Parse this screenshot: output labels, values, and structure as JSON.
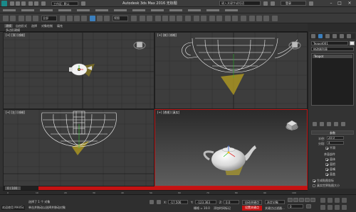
{
  "titlebar": {
    "workspace": "工作区: 默认",
    "title": "Autodesk 3ds Max 2016     无标题",
    "search_placeholder": "键入关键字或短语",
    "login": "登录"
  },
  "ribbon": {
    "tabs": [
      "建模",
      "自由形式",
      "选择",
      "对象绘制",
      "填充"
    ],
    "subtitle": "多边形建模"
  },
  "toolbar": {
    "selection_filter": "全部",
    "ref_coord": "视图"
  },
  "viewports": {
    "top_left": "[+] [顶] [线框]",
    "top_right": "[+] [前] [线框]",
    "bottom_left": "[+] [左] [线框]",
    "bottom_right": "[+] [透视] [真实]"
  },
  "command_panel": {
    "object_name": "Teapot001",
    "modifier_list": "修改器列表",
    "stack_item": "Teapot",
    "rollout_title": "参数",
    "radius_label": "半径:",
    "radius_value": "20.0",
    "segments_label": "分段:",
    "segments_value": "4",
    "smooth_label": "平滑",
    "parts_title": "茶壶部件",
    "parts": [
      "壶体",
      "壶把",
      "壶嘴",
      "壶盖"
    ],
    "gen_map": "生成贴图坐标",
    "real_world": "真实世界贴图大小",
    "color": "#e6e6e6"
  },
  "timeline": {
    "frame_display": "0 / 100",
    "ruler": [
      "0",
      "10",
      "20",
      "30",
      "40",
      "50",
      "60",
      "70",
      "80",
      "90",
      "100"
    ]
  },
  "statusbar": {
    "welcome": "欢迎使用 MAXSc",
    "status_line1": "选择了 1 个 对象",
    "status_line2": "单击并拖动以选择并移动对象",
    "x_label": "X:",
    "x_value": "-17.506",
    "y_label": "Y:",
    "y_value": "-123.363",
    "z_label": "Z:",
    "z_value": "0.0",
    "grid": "栅格 = 10.0",
    "add_time_tag": "添加时间标记",
    "auto_key": "自动关键点",
    "set_key": "设置关键点",
    "key_filter": "选定对象",
    "key_filters_btn": "关键点过滤器...",
    "frame": "0"
  }
}
